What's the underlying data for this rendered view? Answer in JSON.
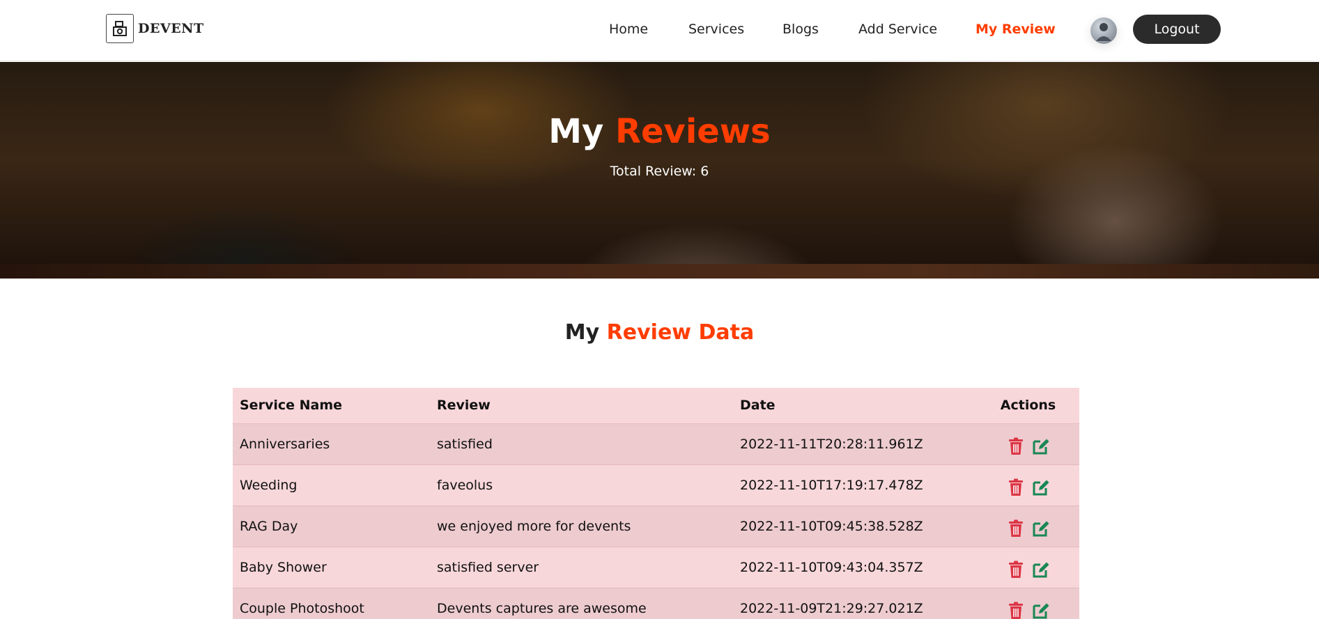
{
  "brand": {
    "name": "DEVENT"
  },
  "nav": {
    "items": [
      {
        "label": "Home",
        "active": false
      },
      {
        "label": "Services",
        "active": false
      },
      {
        "label": "Blogs",
        "active": false
      },
      {
        "label": "Add Service",
        "active": false
      },
      {
        "label": "My Review",
        "active": true
      }
    ],
    "logout_label": "Logout"
  },
  "hero": {
    "title_plain": "My",
    "title_accent": "Reviews",
    "subtitle": "Total Review: 6"
  },
  "section": {
    "title_plain": "My",
    "title_accent": "Review Data"
  },
  "table": {
    "headers": [
      "Service Name",
      "Review",
      "Date",
      "Actions"
    ],
    "rows": [
      {
        "service": "Anniversaries",
        "review": "satisfied",
        "date": "2022-11-11T20:28:11.961Z"
      },
      {
        "service": "Weeding",
        "review": "faveolus",
        "date": "2022-11-10T17:19:17.478Z"
      },
      {
        "service": "RAG Day",
        "review": "we enjoyed more for devents",
        "date": "2022-11-10T09:45:38.528Z"
      },
      {
        "service": "Baby Shower",
        "review": "satisfied server",
        "date": "2022-11-10T09:43:04.357Z"
      },
      {
        "service": "Couple Photoshoot",
        "review": "Devents captures are awesome",
        "date": "2022-11-09T21:29:27.021Z"
      }
    ]
  },
  "icons": {
    "delete": "trash-icon",
    "edit": "edit-icon",
    "logo": "camera-icon"
  },
  "colors": {
    "accent": "#ff3d00",
    "delete": "#dc3545",
    "edit": "#198754",
    "table_header": "#f8d7da",
    "table_row_alt": "#edcbcf",
    "logout_bg": "#2b2b2b"
  }
}
